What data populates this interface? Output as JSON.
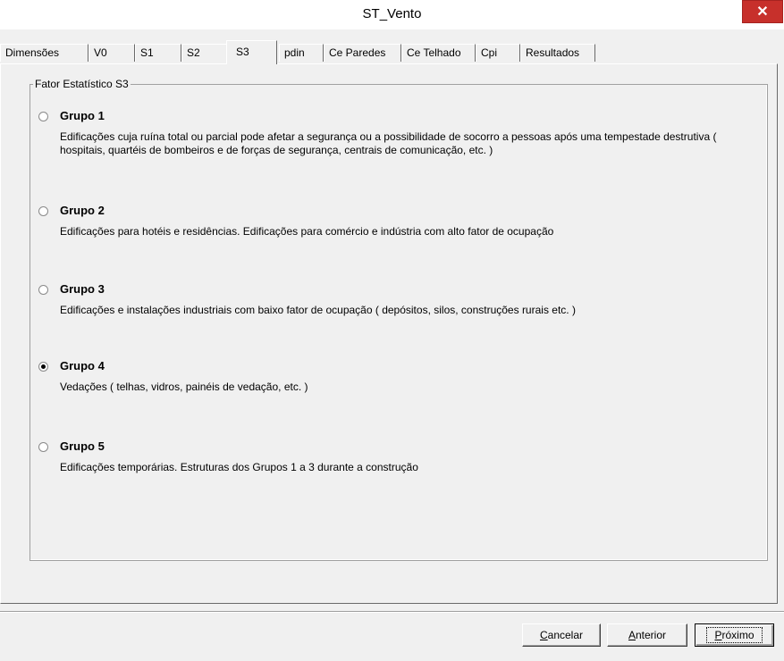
{
  "window": {
    "title": "ST_Vento",
    "close_glyph": "✕"
  },
  "tabs": [
    {
      "label": "Dimensões"
    },
    {
      "label": "V0"
    },
    {
      "label": "S1"
    },
    {
      "label": "S2"
    },
    {
      "label": "S3",
      "active": true
    },
    {
      "label": "pdin"
    },
    {
      "label": "Ce Paredes"
    },
    {
      "label": "Ce Telhado"
    },
    {
      "label": "Cpi"
    },
    {
      "label": "Resultados"
    }
  ],
  "groupbox": {
    "legend": "Fator Estatístico S3",
    "options": [
      {
        "title": "Grupo 1",
        "description": "Edificações cuja ruína total ou parcial pode afetar a segurança ou a possibilidade de socorro a pessoas após uma tempestade destrutiva ( hospitais, quartéis de bombeiros e de forças de segurança, centrais de comunicação, etc. )",
        "selected": false
      },
      {
        "title": "Grupo 2",
        "description": "Edificações para hotéis e residências. Edificações para comércio e indústria com alto fator de ocupação",
        "selected": false
      },
      {
        "title": "Grupo 3",
        "description": "Edificações e instalações industriais com baixo fator de ocupação ( depósitos, silos, construções rurais etc. )",
        "selected": false
      },
      {
        "title": "Grupo 4",
        "description": "Vedações ( telhas, vidros, painéis de vedação, etc. )",
        "selected": true
      },
      {
        "title": "Grupo 5",
        "description": "Edificações temporárias. Estruturas dos Grupos 1 a 3 durante a construção",
        "selected": false
      }
    ]
  },
  "buttons": {
    "cancel": {
      "accel": "C",
      "rest": "ancelar"
    },
    "back": {
      "accel": "A",
      "rest": "nterior"
    },
    "next": {
      "accel": "P",
      "rest": "róximo"
    }
  }
}
